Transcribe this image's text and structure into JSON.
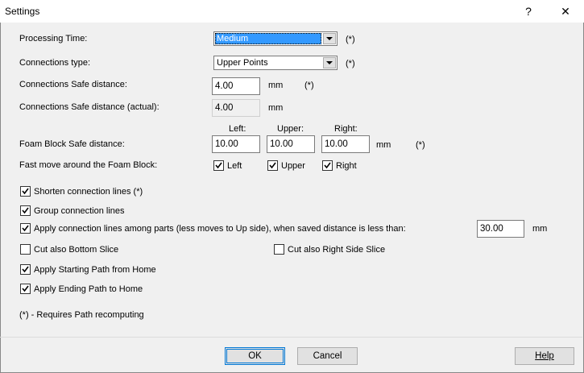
{
  "window": {
    "title": "Settings",
    "help_glyph": "?",
    "close_glyph": "✕"
  },
  "fields": {
    "processing_time": {
      "label": "Processing Time:",
      "value": "Medium",
      "note": "(*)"
    },
    "connections_type": {
      "label": "Connections type:",
      "value": "Upper Points",
      "note": "(*)"
    },
    "safe_distance": {
      "label": "Connections Safe distance:",
      "value": "4.00",
      "unit": "mm",
      "note": "(*)"
    },
    "safe_distance_actual": {
      "label": "Connections Safe distance (actual):",
      "value": "4.00",
      "unit": "mm"
    },
    "foam_block": {
      "label": "Foam Block Safe distance:",
      "left_header": "Left:",
      "upper_header": "Upper:",
      "right_header": "Right:",
      "left": "10.00",
      "upper": "10.00",
      "right": "10.00",
      "unit": "mm",
      "note": "(*)"
    },
    "fast_move": {
      "label": "Fast move around the Foam Block:",
      "left_label": "Left",
      "upper_label": "Upper",
      "right_label": "Right",
      "left_checked": true,
      "upper_checked": true,
      "right_checked": true
    }
  },
  "options": {
    "shorten": {
      "label": "Shorten connection lines (*)",
      "checked": true
    },
    "group": {
      "label": "Group connection lines",
      "checked": true
    },
    "apply_among": {
      "label": "Apply connection lines among parts (less moves to Up side), when saved distance is less than:",
      "value": "30.00",
      "unit": "mm",
      "checked": true
    },
    "bottom_slice": {
      "label": "Cut also Bottom Slice",
      "checked": false
    },
    "right_slice": {
      "label": "Cut also Right Side Slice",
      "checked": false
    },
    "start_home": {
      "label": "Apply Starting Path from Home",
      "checked": true
    },
    "end_home": {
      "label": "Apply Ending Path to Home",
      "checked": true
    }
  },
  "footnote": "(*) - Requires Path recomputing",
  "buttons": {
    "ok": "OK",
    "cancel": "Cancel",
    "help": "Help"
  }
}
